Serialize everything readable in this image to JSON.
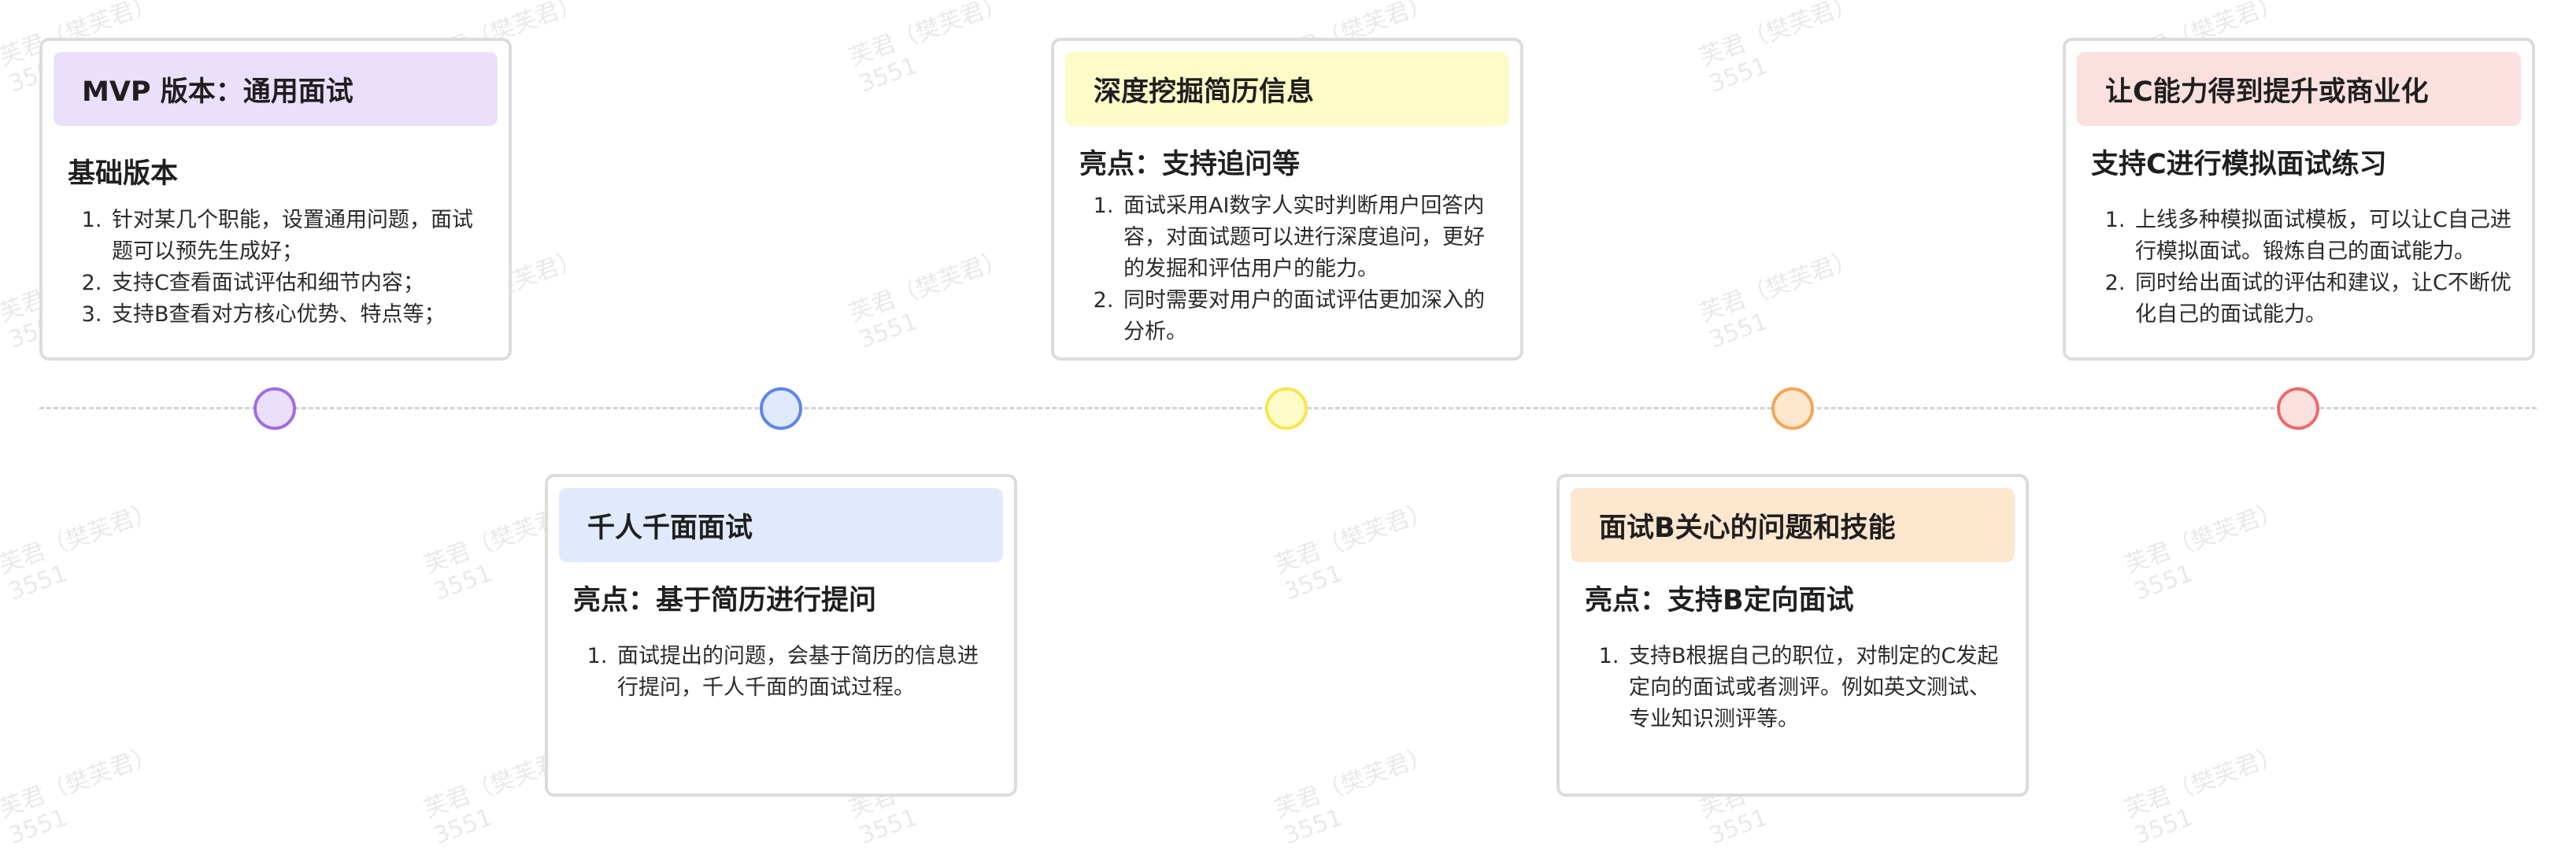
{
  "watermark": {
    "line1": "芙君（樊芙君）",
    "line2": "3551"
  },
  "colors": {
    "purple": "#a16ce8",
    "purple_bg": "#ebe0fb",
    "blue": "#5c86ee",
    "blue_bg": "#e1e9fc",
    "yellow": "#f7e64f",
    "yellow_bg": "#fdfcc8",
    "orange": "#f4a552",
    "orange_bg": "#fde7cf",
    "red": "#ec6a6a",
    "red_bg": "#fbe0e0"
  },
  "stages": [
    {
      "title": "MVP 版本：通用面试",
      "subtitle": "基础版本",
      "items": [
        "针对某几个职能，设置通用问题，面试题可以预先生成好；",
        "支持C查看面试评估和细节内容；",
        "支持B查看对方核心优势、特点等；"
      ]
    },
    {
      "title": "千人千面面试",
      "subtitle": "亮点：基于简历进行提问",
      "items": [
        "面试提出的问题，会基于简历的信息进行提问，千人千面的面试过程。"
      ]
    },
    {
      "title": "深度挖掘简历信息",
      "subtitle": "亮点：支持追问等",
      "items": [
        "面试采用AI数字人实时判断用户回答内容，对面试题可以进行深度追问，更好的发掘和评估用户的能力。",
        "同时需要对用户的面试评估更加深入的分析。"
      ]
    },
    {
      "title": "面试B关心的问题和技能",
      "subtitle": "亮点：支持B定向面试",
      "items": [
        "支持B根据自己的职位，对制定的C发起定向的面试或者测评。例如英文测试、专业知识测评等。"
      ]
    },
    {
      "title": "让C能力得到提升或商业化",
      "subtitle": "支持C进行模拟面试练习",
      "items": [
        "上线多种模拟面试模板，可以让C自己进行模拟面试。锻炼自己的面试能力。",
        "同时给出面试的评估和建议，让C不断优化自己的面试能力。"
      ]
    }
  ]
}
